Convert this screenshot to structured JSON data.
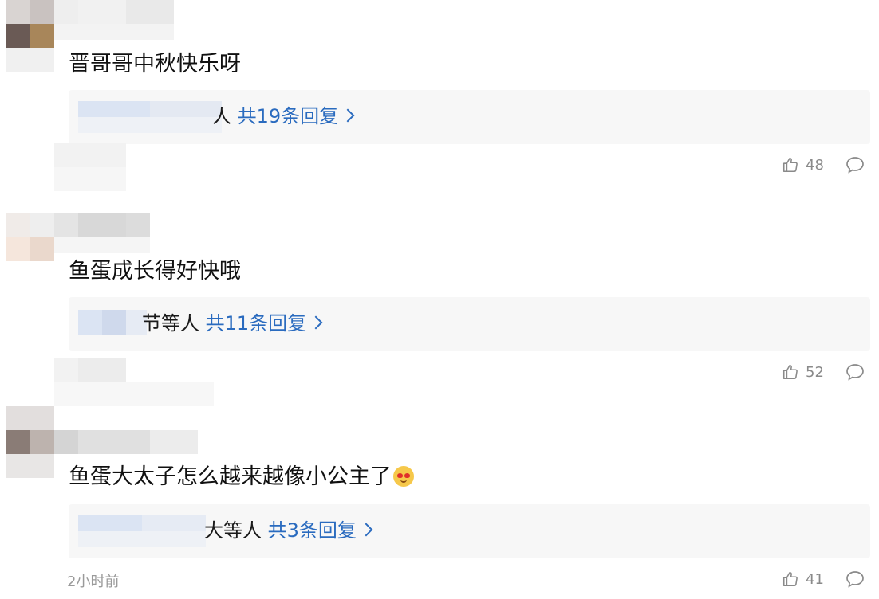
{
  "comments": [
    {
      "text": "晋哥哥中秋快乐呀",
      "reply_names_suffix": "人",
      "reply_count": "共19条回复",
      "likes": "48",
      "colors": {
        "avatar_a": "#6a5a55",
        "avatar_b": "#a8865a"
      }
    },
    {
      "text": "鱼蛋成长得好快哦",
      "reply_names_suffix": "节等人",
      "reply_count": "共11条回复",
      "likes": "52",
      "colors": {
        "avatar_a": "#f5e6dc",
        "avatar_b": "#ead8cc"
      }
    },
    {
      "text": "鱼蛋大太子怎么越来越像小公主了",
      "emoji": "heart-eyes-cat-emoji",
      "reply_names_suffix": "大等人",
      "reply_count": "共3条回复",
      "likes": "41",
      "time": "2小时前",
      "colors": {
        "avatar_a": "#8a7c76",
        "avatar_b": "#bdb3ae"
      }
    }
  ],
  "theme": {
    "link_color": "#2a6bbf",
    "reply_bg": "#f7f7f7",
    "muted_text": "#8a8a8a"
  },
  "icons": [
    "thumbs-up-icon",
    "comment-bubble-icon",
    "chevron-right-icon"
  ]
}
